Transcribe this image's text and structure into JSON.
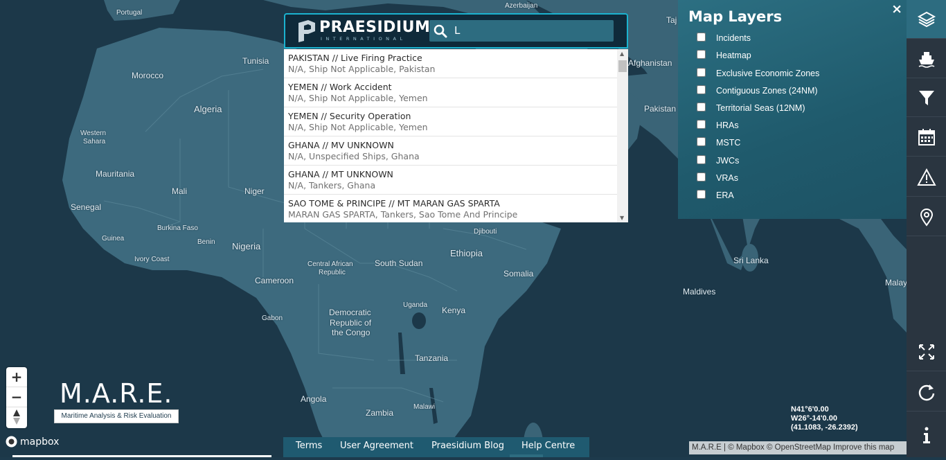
{
  "search": {
    "brand": "PRAESIDIUM",
    "brand_sub": "INTERNATIONAL",
    "query": "L",
    "results": [
      {
        "title": "PAKISTAN // Live Firing Practice",
        "subtitle": "N/A, Ship Not Applicable, Pakistan"
      },
      {
        "title": "YEMEN // Work Accident",
        "subtitle": "N/A, Ship Not Applicable, Yemen"
      },
      {
        "title": "YEMEN // Security Operation",
        "subtitle": "N/A, Ship Not Applicable, Yemen"
      },
      {
        "title": "GHANA // MV UNKNOWN",
        "subtitle": "N/A, Unspecified Ships, Ghana"
      },
      {
        "title": "GHANA // MT UNKNOWN",
        "subtitle": "N/A, Tankers, Ghana"
      },
      {
        "title": "SAO TOME & PRINCIPE // MT MARAN GAS SPARTA",
        "subtitle": "MARAN GAS SPARTA, Tankers, Sao Tome And Principe"
      }
    ]
  },
  "layers": {
    "title": "Map Layers",
    "close": "×",
    "items": [
      {
        "label": "Incidents",
        "checked": false
      },
      {
        "label": "Heatmap",
        "checked": false
      },
      {
        "label": "Exclusive Economic Zones",
        "checked": false
      },
      {
        "label": "Contiguous Zones (24NM)",
        "checked": false
      },
      {
        "label": "Territorial Seas (12NM)",
        "checked": false
      },
      {
        "label": "HRAs",
        "checked": false
      },
      {
        "label": "MSTC",
        "checked": false
      },
      {
        "label": "JWCs",
        "checked": false
      },
      {
        "label": "VRAs",
        "checked": false
      },
      {
        "label": "ERA",
        "checked": false
      }
    ]
  },
  "sidebar": {
    "buttons": [
      {
        "icon": "layers-icon",
        "active": true
      },
      {
        "icon": "ship-icon"
      },
      {
        "icon": "filter-icon"
      },
      {
        "icon": "calendar-icon"
      },
      {
        "icon": "warning-icon"
      },
      {
        "icon": "map-marker-icon"
      },
      {
        "icon": "fullscreen-icon"
      },
      {
        "icon": "refresh-icon"
      },
      {
        "icon": "info-icon"
      }
    ]
  },
  "map": {
    "labels": {
      "portugal": "Portugal",
      "azerbaijan": "Azerbaijan",
      "tunisia": "Tunisia",
      "morocco": "Morocco",
      "algeria": "Algeria",
      "western_sahara_1": "Western",
      "western_sahara_2": "Sahara",
      "mauritania": "Mauritania",
      "mali": "Mali",
      "niger": "Niger",
      "senegal": "Senegal",
      "burkina_faso": "Burkina Faso",
      "guinea": "Guinea",
      "benin": "Benin",
      "nigeria": "Nigeria",
      "ivory_coast": "Ivory Coast",
      "car_1": "Central African",
      "car_2": "Republic",
      "south_sudan": "South Sudan",
      "ethiopia": "Ethiopia",
      "djibouti": "Djibouti",
      "somalia": "Somalia",
      "cameroon": "Cameroon",
      "gabon": "Gabon",
      "drc_1": "Democratic",
      "drc_2": "Republic of",
      "drc_3": "the Congo",
      "uganda": "Uganda",
      "kenya": "Kenya",
      "tanzania": "Tanzania",
      "angola": "Angola",
      "malawi": "Malawi",
      "zambia": "Zambia",
      "afghanistan": "Afghanistan",
      "pakistan": "Pakistan",
      "sri_lanka": "Sri Lanka",
      "maldives": "Maldives",
      "malaysia": "Malay",
      "taj": "Taj"
    }
  },
  "zoom": {
    "plus": "+",
    "minus": "−"
  },
  "mare": {
    "title": "M.A.R.E.",
    "subtitle": "Maritime Analysis & Risk Evaluation"
  },
  "mapbox": {
    "label": "mapbox"
  },
  "footer": {
    "links": [
      "Terms",
      "User Agreement",
      "Praesidium Blog",
      "Help Centre"
    ]
  },
  "coords": {
    "lat": "N41°6'0.00",
    "lon": "W26°-14'0.00",
    "decimal": "(41.1083, -26.2392)"
  },
  "attribution": "M.A.R.E | © Mapbox © OpenStreetMap Improve this map"
}
